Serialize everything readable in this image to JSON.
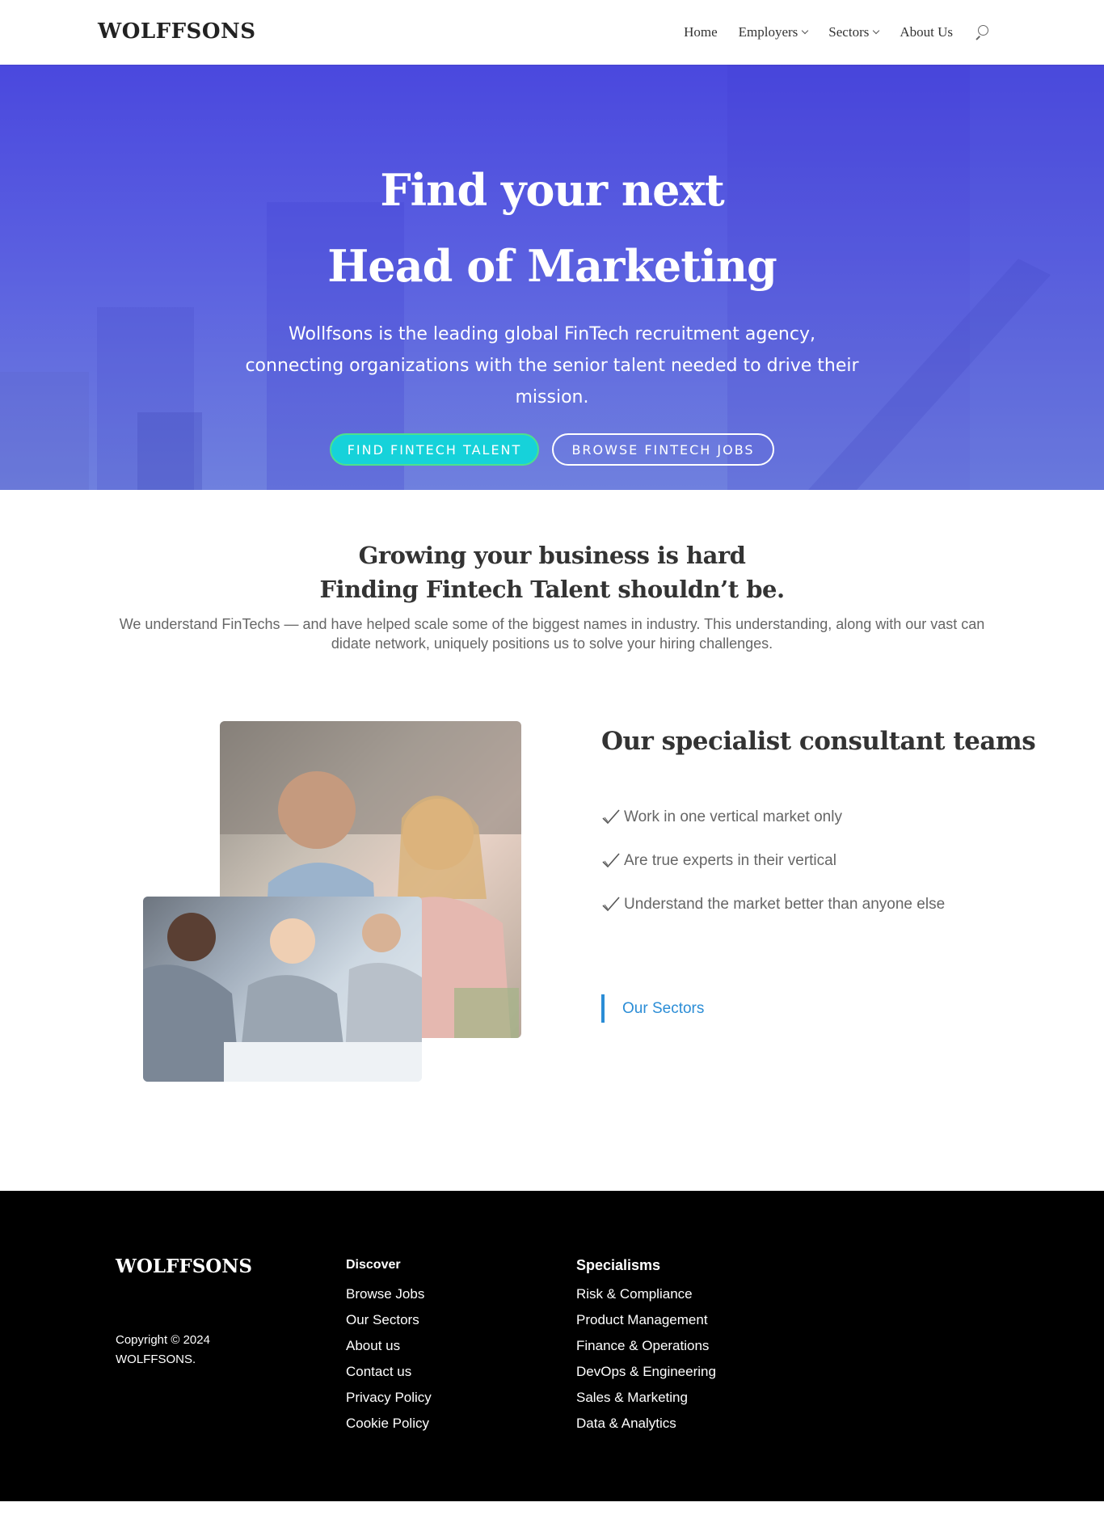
{
  "header": {
    "logo": "WOLFFSONS",
    "nav": [
      {
        "label": "Home",
        "has_dropdown": false
      },
      {
        "label": "Employers",
        "has_dropdown": true
      },
      {
        "label": "Sectors",
        "has_dropdown": true
      },
      {
        "label": "About Us",
        "has_dropdown": false
      }
    ],
    "search_icon": "search-icon"
  },
  "hero": {
    "title_line1": "Find your next",
    "title_line2": "Head of Marketing",
    "subtitle": "Wollfsons is the leading global FinTech recruitment agency, connecting organizations with the senior talent needed to drive their mission.",
    "primary_button": "FIND FINTECH TALENT",
    "secondary_button": "BROWSE FINTECH JOBS",
    "arrow_icon": "arrow-down-icon",
    "colors": {
      "gradient_top": "#4a48de",
      "gradient_bottom": "#6f80de",
      "primary_button": "#16d2da"
    }
  },
  "intro": {
    "heading_line1": "Growing your business is hard",
    "heading_line2": "Finding Fintech Talent shouldn’t be.",
    "body": "We understand FinTechs — and have helped scale some of the biggest names in industry. This understanding, along with our vast candidate network, uniquely positions us to solve your hiring challenges."
  },
  "consultants": {
    "title": "Our specialist consultant teams",
    "points": [
      "Work in one vertical market only",
      "Are true experts in their vertical",
      "Understand the market better than anyone else"
    ],
    "link": "Our Sectors",
    "link_color": "#2b8dd6",
    "check_icon": "checkmark-icon"
  },
  "footer": {
    "logo": "WOLFFSONS",
    "copyright": "Copyright © 2024 WOLFFSONS.",
    "discover": {
      "heading": "Discover",
      "links": [
        "Browse Jobs",
        "Our Sectors",
        "About us",
        "Contact us",
        "Privacy Policy",
        "Cookie Policy"
      ]
    },
    "specialisms": {
      "heading": "Specialisms",
      "links": [
        "Risk & Compliance",
        "Product Management",
        "Finance & Operations",
        "DevOps & Engineering",
        "Sales & Marketing",
        "Data & Analytics"
      ]
    }
  }
}
